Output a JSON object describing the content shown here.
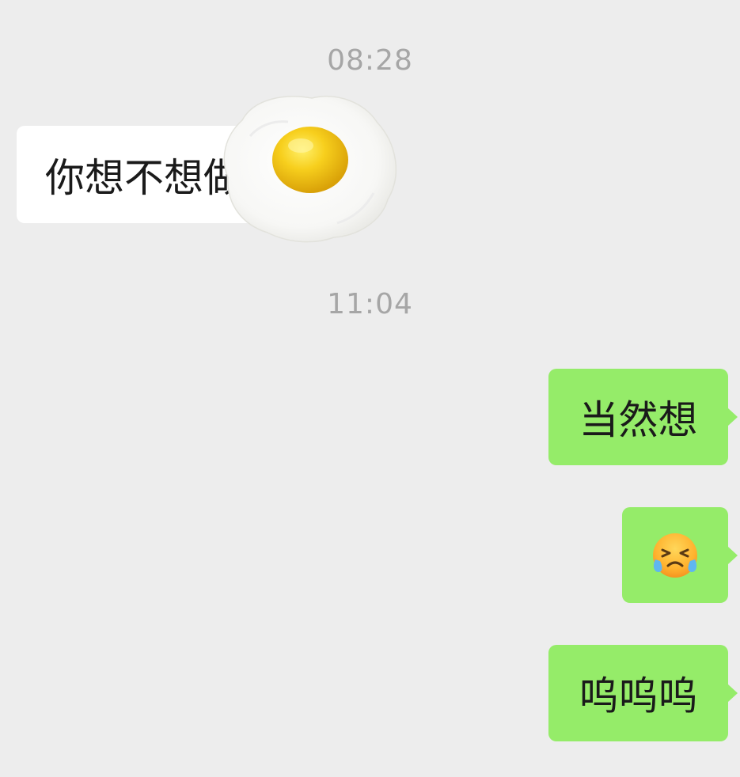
{
  "chat": {
    "timestamps": [
      "08:28",
      "11:04"
    ],
    "incoming_message": {
      "text": "你想不想做",
      "sticker": "fried-egg-sticker"
    },
    "outgoing_messages": [
      {
        "text": "当然想"
      },
      {
        "emoji": "crying-laughing-face-emoji"
      },
      {
        "text": "呜呜呜"
      }
    ]
  },
  "colors": {
    "background": "#ededed",
    "incoming_bubble": "#ffffff",
    "outgoing_bubble": "#95ec69",
    "timestamp_text": "#a6a6a6"
  }
}
